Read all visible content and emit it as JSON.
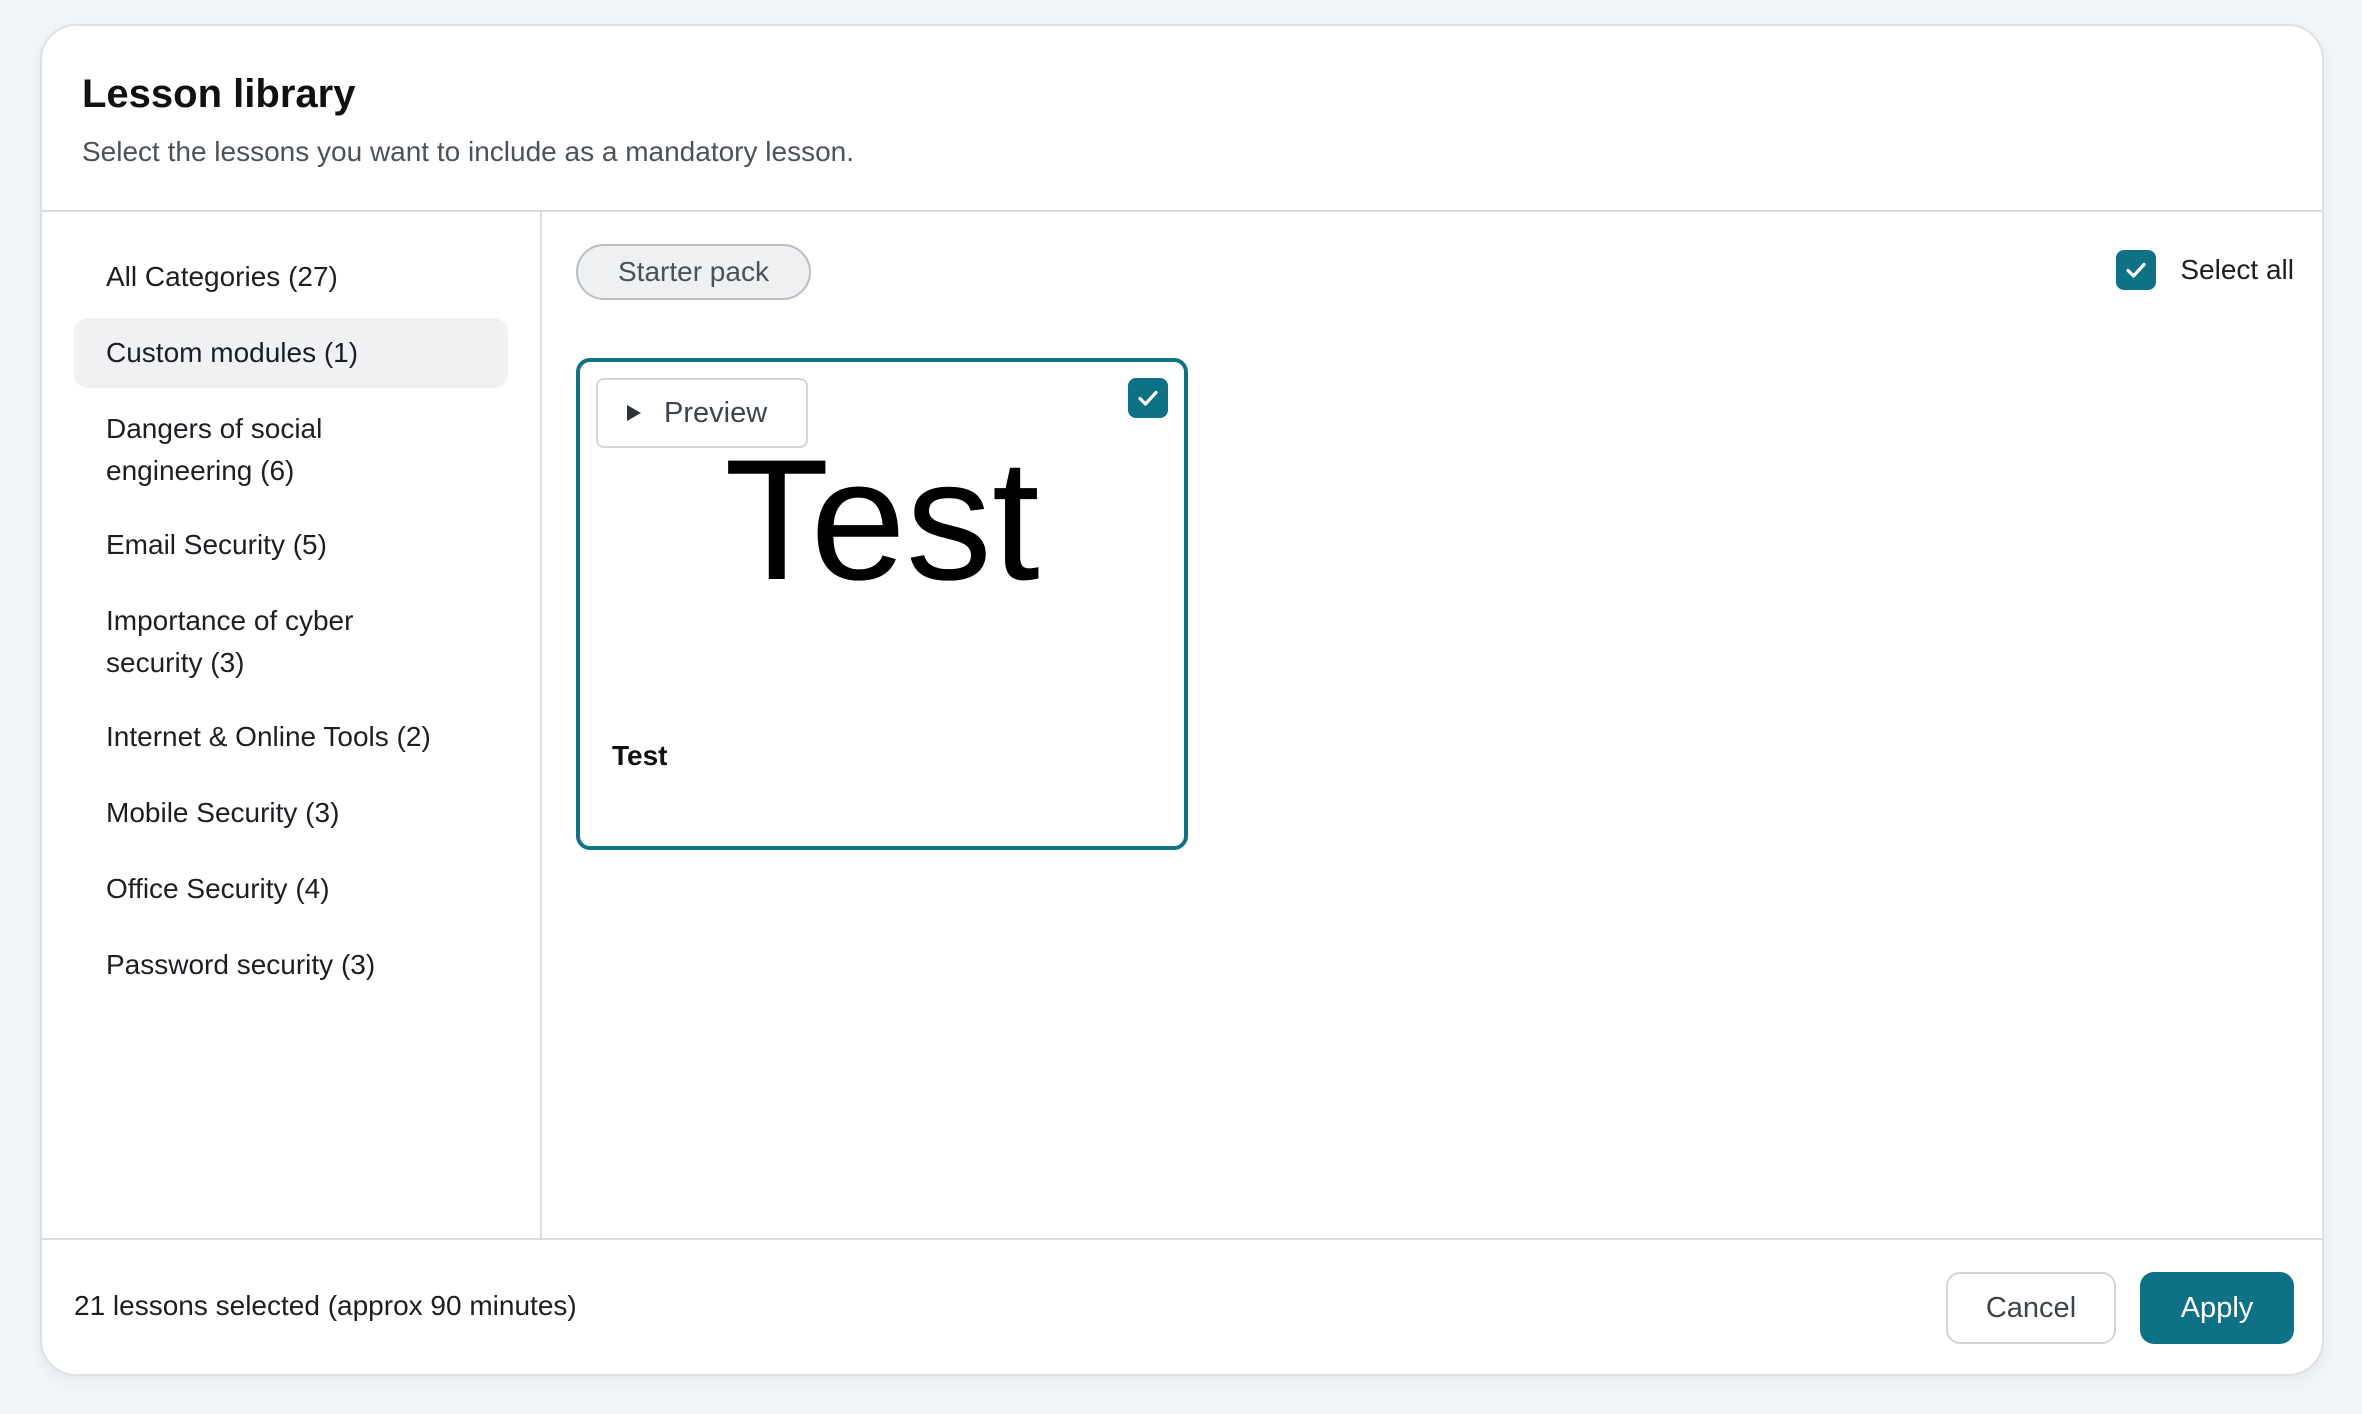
{
  "header": {
    "title": "Lesson library",
    "subtitle": "Select the lessons you want to include as a mandatory lesson."
  },
  "sidebar": {
    "items": [
      {
        "label": "All Categories (27)",
        "active": false
      },
      {
        "label": "Custom modules (1)",
        "active": true
      },
      {
        "label": "Dangers of social engineering (6)",
        "active": false
      },
      {
        "label": "Email Security (5)",
        "active": false
      },
      {
        "label": "Importance of cyber security (3)",
        "active": false
      },
      {
        "label": "Internet & Online Tools (2)",
        "active": false
      },
      {
        "label": "Mobile Security (3)",
        "active": false
      },
      {
        "label": "Office Security (4)",
        "active": false
      },
      {
        "label": "Password security (3)",
        "active": false
      }
    ]
  },
  "content": {
    "filter_chip": "Starter pack",
    "select_all_label": "Select all",
    "select_all_checked": true,
    "lessons": [
      {
        "preview_label": "Preview",
        "thumbnail_text": "Test",
        "title": "Test",
        "checked": true
      }
    ]
  },
  "footer": {
    "status": "21 lessons selected (approx 90 minutes)",
    "cancel_label": "Cancel",
    "apply_label": "Apply"
  },
  "colors": {
    "accent": "#0e7185",
    "active_item_bg": "#f0f1f3"
  },
  "icons": {
    "play": "play-icon",
    "check": "check-icon"
  }
}
